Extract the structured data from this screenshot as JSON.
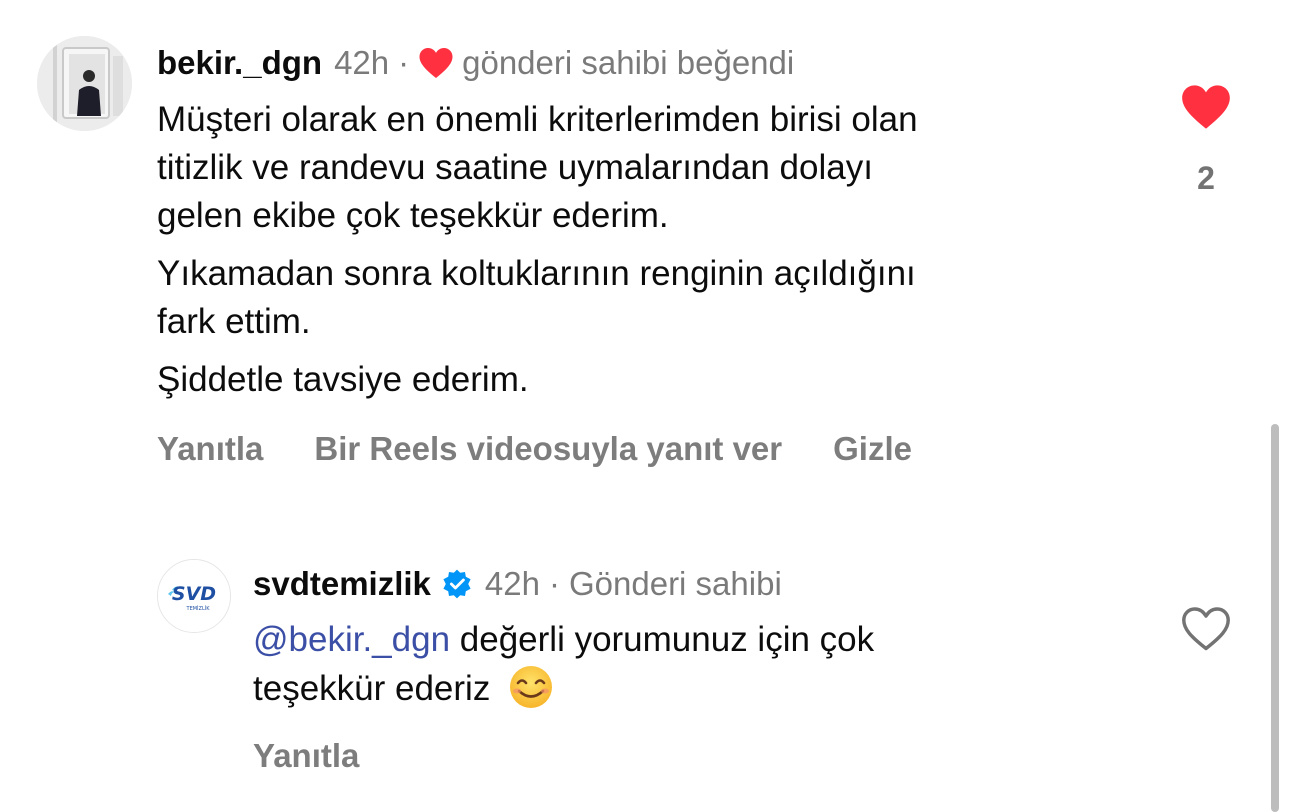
{
  "comment": {
    "username": "bekir._dgn",
    "time": "42h",
    "separator": "·",
    "author_liked_text": "gönderi sahibi beğendi",
    "paragraphs": [
      "Müşteri olarak en önemli kriterlerimden birisi olan",
      "titizlik ve randevu saatine uymalarından dolayı",
      "gelen ekibe çok teşekkür ederim.",
      "Yıkamadan sonra koltuklarının renginin açıldığını",
      "fark ettim.",
      "Şiddetle tavsiye ederim."
    ],
    "actions": {
      "reply": "Yanıtla",
      "reels_reply": "Bir Reels videosuyla yanıt ver",
      "hide": "Gizle"
    },
    "like_count": "2",
    "liked": true,
    "like_icon": "heart-filled-icon"
  },
  "reply": {
    "username": "svdtemizlik",
    "verified_icon": "verified-badge-icon",
    "time": "42h",
    "separator": "·",
    "role": "Gönderi sahibi",
    "mention": "@bekir._dgn",
    "text_line1": " değerli yorumunuz için çok",
    "text_line2": "teşekkür ederiz",
    "emoji": "smiling-face-emoji",
    "reply_action": "Yanıtla",
    "liked": false,
    "like_icon": "heart-outline-icon",
    "logo": {
      "text": "SVD",
      "subtext": "TEMİZLİK"
    }
  },
  "colors": {
    "like_red": "#ff3040",
    "mention_blue": "#3c4fa6",
    "muted_gray": "#7a7a7a",
    "verified_blue": "#0095f6",
    "text": "#0c0c0c"
  }
}
